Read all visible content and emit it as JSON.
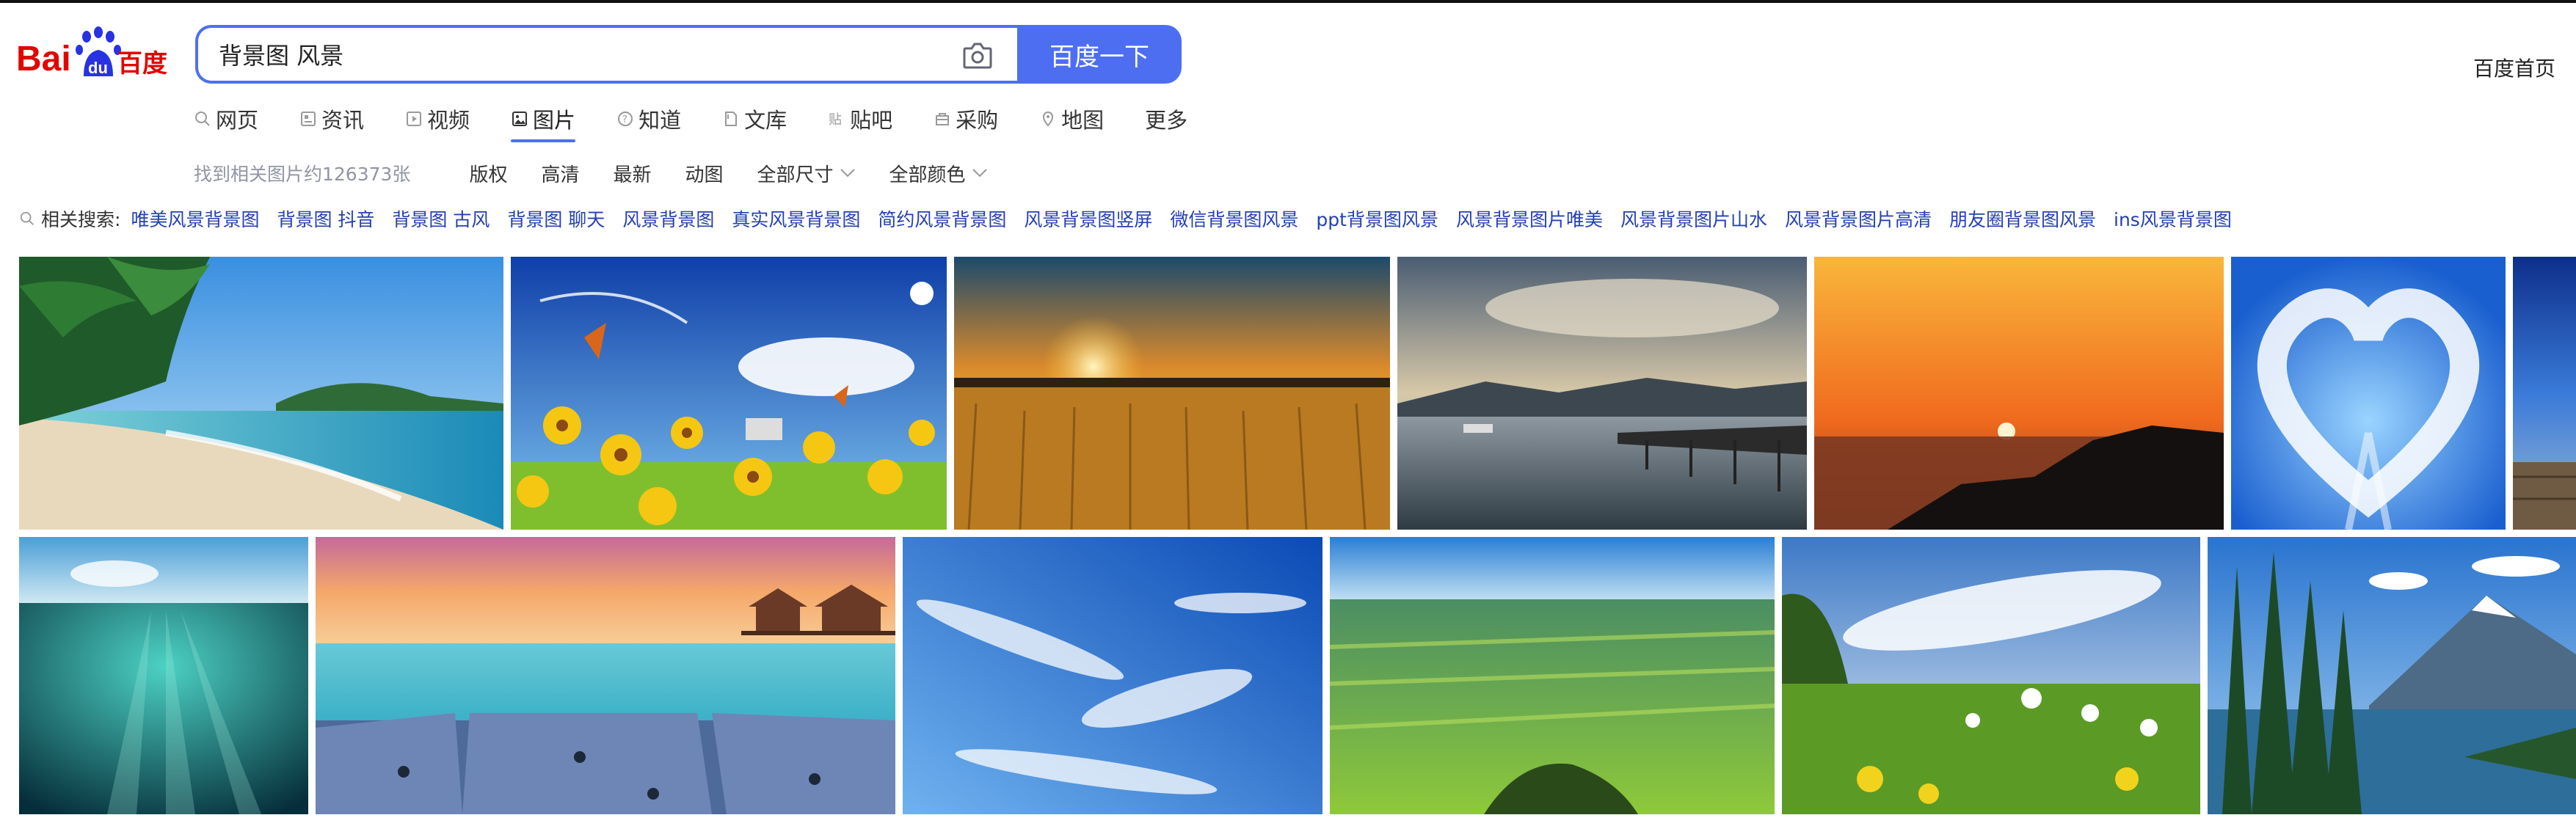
{
  "header": {
    "logo_text_left": "Bai",
    "logo_text_du": "du",
    "logo_text_right": "百度",
    "search_query": "背景图 风景",
    "search_button": "百度一下",
    "home_link": "百度首页"
  },
  "tabs": [
    {
      "label": "网页",
      "icon": "search-icon"
    },
    {
      "label": "资讯",
      "icon": "news-icon"
    },
    {
      "label": "视频",
      "icon": "video-icon"
    },
    {
      "label": "图片",
      "icon": "image-icon",
      "active": true
    },
    {
      "label": "知道",
      "icon": "question-icon"
    },
    {
      "label": "文库",
      "icon": "document-icon"
    },
    {
      "label": "贴吧",
      "icon": "tieba-icon"
    },
    {
      "label": "采购",
      "icon": "shopping-icon"
    },
    {
      "label": "地图",
      "icon": "map-icon"
    },
    {
      "label": "更多"
    }
  ],
  "filters": {
    "result_count": "找到相关图片约126373张",
    "items": [
      "版权",
      "高清",
      "最新",
      "动图"
    ],
    "dropdowns": [
      "全部尺寸",
      "全部颜色"
    ]
  },
  "related": {
    "label": "相关搜索:",
    "items": [
      "唯美风景背景图",
      "背景图 抖音",
      "背景图 古风",
      "背景图 聊天",
      "风景背景图",
      "真实风景背景图",
      "简约风景背景图",
      "风景背景图竖屏",
      "微信背景图风景",
      "ppt背景图风景",
      "风景背景图片唯美",
      "风景背景图片山水",
      "风景背景图片高清",
      "朋友圈背景图风景",
      "ins风景背景图"
    ]
  },
  "colors": {
    "accent": "#4e6ef2",
    "link": "#2440b3",
    "logo_red": "#e10601",
    "logo_blue": "#2932e1"
  }
}
